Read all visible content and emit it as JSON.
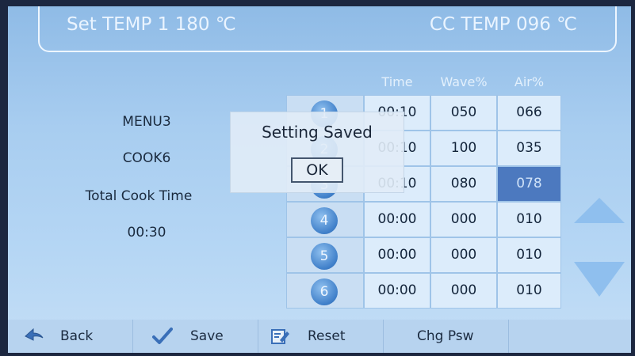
{
  "header": {
    "set_temp": "Set TEMP 1 180 ℃",
    "cc_temp": "CC TEMP 096 ℃"
  },
  "info": {
    "menu": "MENU3",
    "cook": "COOK6",
    "total_label": "Total Cook Time",
    "total_time": "00:30"
  },
  "table": {
    "headers": [
      "Time",
      "Wave%",
      "Air%"
    ],
    "rows": [
      {
        "step": "1",
        "time": "00:10",
        "wave": "050",
        "air": "066"
      },
      {
        "step": "2",
        "time": "00:10",
        "wave": "100",
        "air": "035"
      },
      {
        "step": "3",
        "time": "00:10",
        "wave": "080",
        "air": "078"
      },
      {
        "step": "4",
        "time": "00:00",
        "wave": "000",
        "air": "010"
      },
      {
        "step": "5",
        "time": "00:00",
        "wave": "000",
        "air": "010"
      },
      {
        "step": "6",
        "time": "00:00",
        "wave": "000",
        "air": "010"
      }
    ]
  },
  "dialog": {
    "message": "Setting Saved",
    "ok_label": "OK"
  },
  "toolbar": {
    "back": "Back",
    "save": "Save",
    "reset": "Reset",
    "chg_psw": "Chg Psw"
  },
  "colors": {
    "screen_bg": "#a8cdf0",
    "cell_bg": "#dcecfb",
    "selected_cell": "#4c79bf",
    "arrow": "#8fbfee"
  }
}
